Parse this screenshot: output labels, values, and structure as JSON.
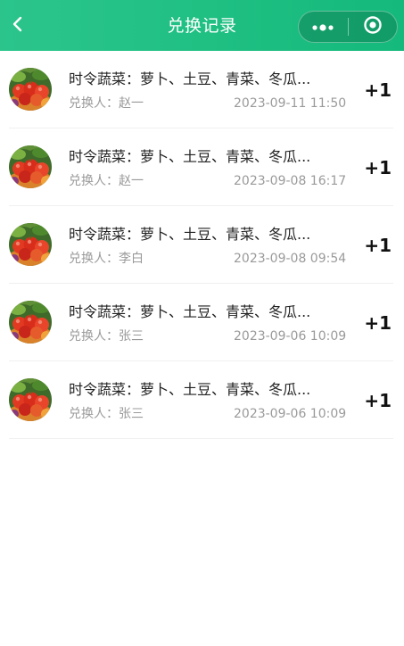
{
  "header": {
    "title": "兑换记录",
    "back_icon": "chevron-left-icon",
    "menu_icon": "more-dots-icon",
    "close_icon": "target-circle-icon",
    "gradient": [
      "#2bc58c",
      "#14b97b"
    ]
  },
  "records": [
    {
      "title": "时令蔬菜：萝卜、土豆、青菜、冬瓜...",
      "person": "兑换人：赵一",
      "time": "2023-09-11 11:50",
      "qty": "+1"
    },
    {
      "title": "时令蔬菜：萝卜、土豆、青菜、冬瓜...",
      "person": "兑换人：赵一",
      "time": "2023-09-08 16:17",
      "qty": "+1"
    },
    {
      "title": "时令蔬菜：萝卜、土豆、青菜、冬瓜...",
      "person": "兑换人：李白",
      "time": "2023-09-08 09:54",
      "qty": "+1"
    },
    {
      "title": "时令蔬菜：萝卜、土豆、青菜、冬瓜...",
      "person": "兑换人：张三",
      "time": "2023-09-06 10:09",
      "qty": "+1"
    },
    {
      "title": "时令蔬菜：萝卜、土豆、青菜、冬瓜...",
      "person": "兑换人：张三",
      "time": "2023-09-06 10:09",
      "qty": "+1"
    }
  ]
}
